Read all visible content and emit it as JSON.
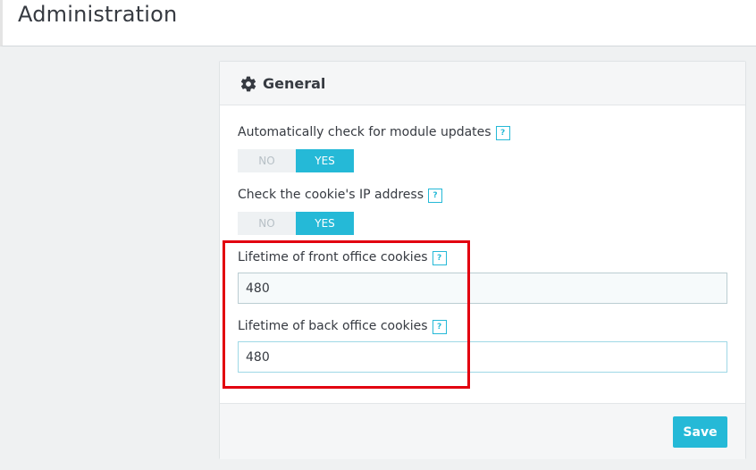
{
  "header": {
    "title": "Administration"
  },
  "panel": {
    "title": "General",
    "icon": "gear-icon",
    "fields": {
      "module_updates": {
        "label": "Automatically check for module updates",
        "help": "?",
        "no_label": "NO",
        "yes_label": "YES",
        "selected": "YES"
      },
      "cookie_ip": {
        "label": "Check the cookie's IP address",
        "help": "?",
        "no_label": "NO",
        "yes_label": "YES",
        "selected": "YES"
      },
      "front_cookie_lifetime": {
        "label": "Lifetime of front office cookies",
        "help": "?",
        "value": "480"
      },
      "back_cookie_lifetime": {
        "label": "Lifetime of back office cookies",
        "help": "?",
        "value": "480"
      }
    },
    "footer": {
      "save_label": "Save"
    }
  },
  "colors": {
    "accent": "#25b9d7",
    "highlight": "#e2000f"
  }
}
